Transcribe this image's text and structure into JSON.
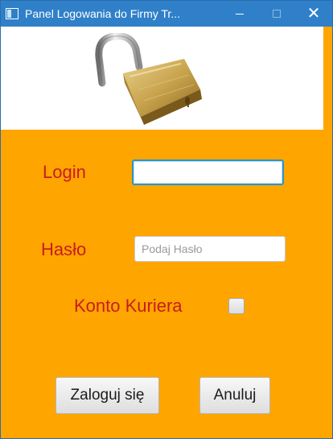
{
  "window": {
    "title": "Panel Logowania do Firmy Tr...",
    "icon": "java-window-icon",
    "controls": [
      "minimize-icon",
      "maximize-icon",
      "close-icon"
    ],
    "close_glyph": "✕"
  },
  "header_image": {
    "icon": "padlock-open-icon"
  },
  "form": {
    "login_label": "Login",
    "login_value": "",
    "password_label": "Hasło",
    "password_placeholder": "Podaj Hasło",
    "password_value": "",
    "courier_label": "Konto Kuriera",
    "courier_checked": false
  },
  "buttons": {
    "login": "Zaloguj się",
    "cancel": "Anuluj"
  },
  "colors": {
    "background": "#ffa500",
    "label_text": "#c81d1d",
    "titlebar": "#2f80c8"
  }
}
